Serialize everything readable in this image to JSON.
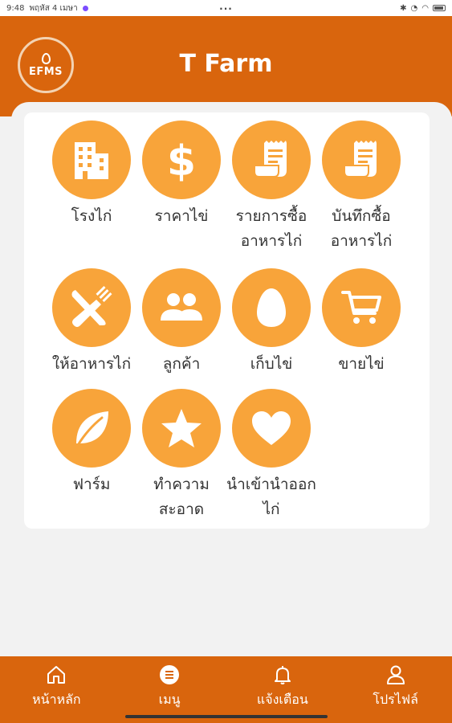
{
  "status_bar": {
    "time": "9:48",
    "date": "พฤหัส 4 เมษา",
    "center": "...",
    "icons": [
      "bluetooth-icon",
      "alarm-icon",
      "wifi-icon",
      "battery-icon"
    ]
  },
  "header": {
    "title": "T Farm",
    "logo_text": "EFMS",
    "background_color": "#d9650d"
  },
  "menu": {
    "accent_color": "#f8a43a",
    "items": [
      {
        "label": "โรงไก่",
        "icon": "building-icon"
      },
      {
        "label": "ราคาไข่",
        "icon": "dollar-icon"
      },
      {
        "label": "รายการซื้ออาหารไก่",
        "icon": "receipt-icon"
      },
      {
        "label": "บันทึกซื้ออาหารไก่",
        "icon": "receipt-icon"
      },
      {
        "label": "ให้อาหารไก่",
        "icon": "fork-knife-icon"
      },
      {
        "label": "ลูกค้า",
        "icon": "people-icon"
      },
      {
        "label": "เก็บไข่",
        "icon": "egg-icon"
      },
      {
        "label": "ขายไข่",
        "icon": "cart-icon"
      },
      {
        "label": "ฟาร์ม",
        "icon": "leaf-icon"
      },
      {
        "label": "ทำความสะอาด",
        "icon": "star-icon"
      },
      {
        "label": "นำเข้านำออกไก่",
        "icon": "heart-icon"
      }
    ]
  },
  "bottom_nav": {
    "items": [
      {
        "label": "หน้าหลัก",
        "icon": "home-icon"
      },
      {
        "label": "เมนู",
        "icon": "list-icon"
      },
      {
        "label": "แจ้งเตือน",
        "icon": "bell-icon"
      },
      {
        "label": "โปรไฟล์",
        "icon": "user-icon"
      }
    ]
  }
}
